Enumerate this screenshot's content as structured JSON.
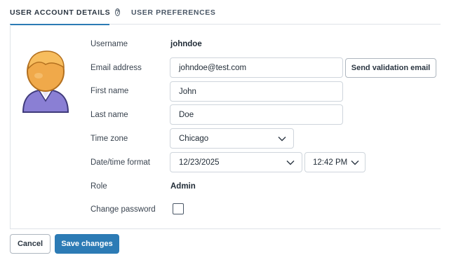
{
  "tabs": [
    {
      "label": "USER ACCOUNT DETAILS",
      "active": true
    },
    {
      "label": "USER PREFERENCES",
      "active": false
    }
  ],
  "help_icon_glyph": "?",
  "form": {
    "username": {
      "label": "Username",
      "value": "johndoe"
    },
    "email": {
      "label": "Email address",
      "value": "johndoe@test.com",
      "action": "Send validation email"
    },
    "first_name": {
      "label": "First name",
      "value": "John"
    },
    "last_name": {
      "label": "Last name",
      "value": "Doe"
    },
    "time_zone": {
      "label": "Time zone",
      "value": "Chicago"
    },
    "datetime_format": {
      "label": "Date/time format",
      "date_value": "12/23/2025",
      "time_value": "12:42 PM"
    },
    "role": {
      "label": "Role",
      "value": "Admin"
    },
    "change_password": {
      "label": "Change password",
      "checked": false
    }
  },
  "footer": {
    "cancel_label": "Cancel",
    "save_label": "Save changes"
  },
  "colors": {
    "accent": "#2c7bb5",
    "avatar_skin": "#f0a94a",
    "avatar_shirt": "#8a7fd4"
  },
  "icons": {
    "avatar": "user-avatar-icon",
    "help": "help-circle-icon",
    "chevron": "chevron-down-icon"
  }
}
